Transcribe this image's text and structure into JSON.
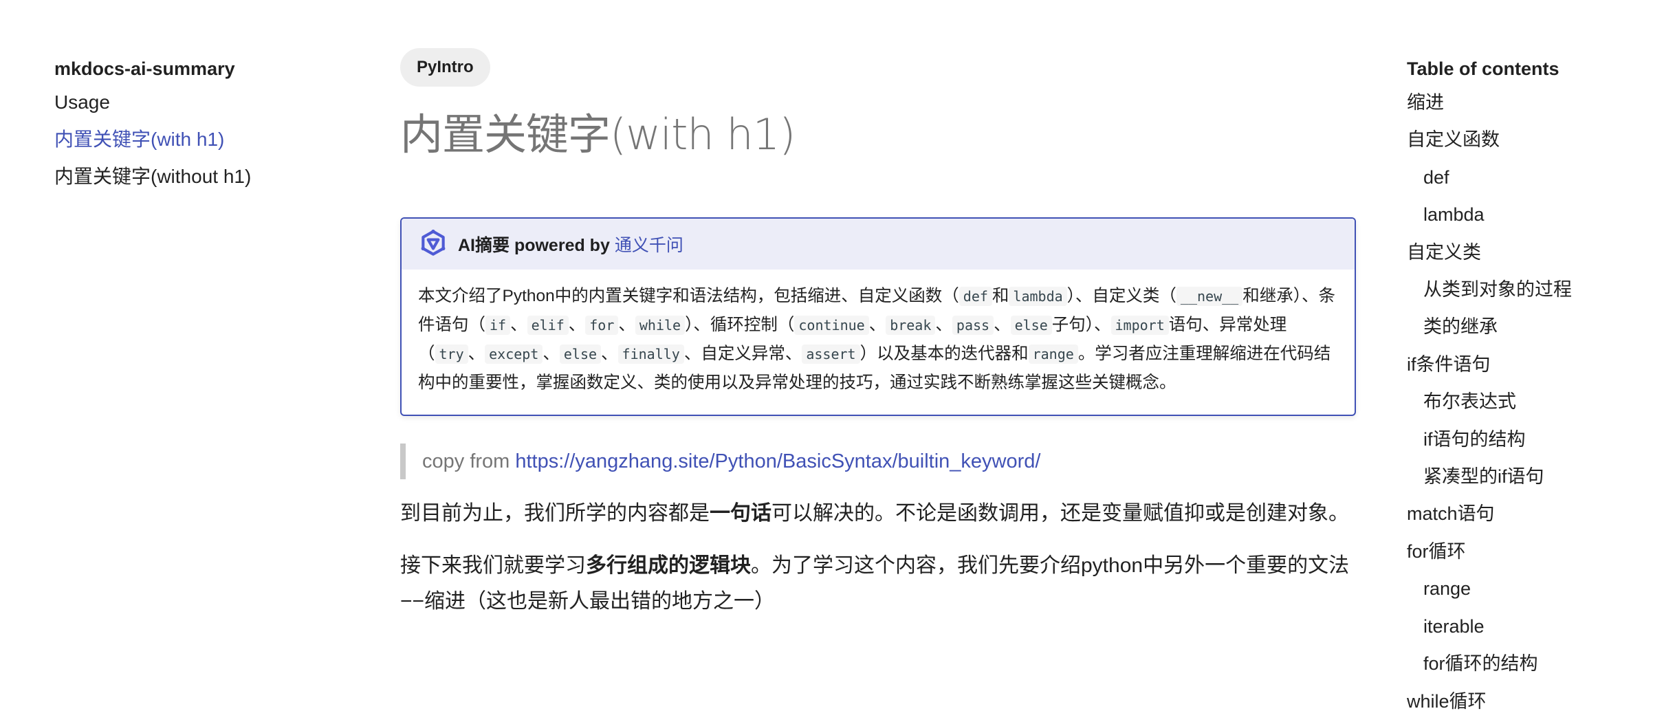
{
  "nav": {
    "site_title": "mkdocs-ai-summary",
    "items": [
      {
        "label": "Usage",
        "active": false
      },
      {
        "label": "内置关键字(with h1)",
        "active": true
      },
      {
        "label": "内置关键字(without h1)",
        "active": false
      }
    ]
  },
  "page": {
    "tag": "PyIntro",
    "title": "内置关键字(with h1)",
    "summary": {
      "title_prefix": "AI摘要 powered by",
      "title_link": "通义千问",
      "logo_icon": "tongyi-logo-icon",
      "accent_color": "#4051b5",
      "parts": {
        "t1": "本文介绍了Python中的内置关键字和语法结构，包括缩进、自定义函数（",
        "c_def": "def",
        "t2": "和",
        "c_lambda": "lambda",
        "t3": "）、自定义类（",
        "c_new": "__new__",
        "t4": "和继承）、条件语句（",
        "c_if": "if",
        "s1": "、",
        "c_elif": "elif",
        "s2": "、",
        "c_for": "for",
        "s3": "、",
        "c_while": "while",
        "t5": "）、循环控制（",
        "c_continue": "continue",
        "s4": "、",
        "c_break": "break",
        "s5": "、",
        "c_pass": "pass",
        "s6": "、",
        "c_else1": "else",
        "t6": "子句）、",
        "c_import": "import",
        "t7": "语句、异常处理（",
        "c_try": "try",
        "s7": "、",
        "c_except": "except",
        "s8": "、",
        "c_else2": "else",
        "s9": "、",
        "c_finally": "finally",
        "t8": "、自定义异常、",
        "c_assert": "assert",
        "t9": "）以及基本的迭代器和",
        "c_range": "range",
        "t10": "。学习者应注重理解缩进在代码结构中的重要性，掌握函数定义、类的使用以及异常处理的技巧，通过实践不断熟练掌握这些关键概念。"
      }
    },
    "quote": {
      "prefix": "copy from ",
      "link": "https://yangzhang.site/Python/BasicSyntax/builtin_keyword/"
    },
    "para1": {
      "a": "到目前为止，我们所学的内容都是",
      "b": "一句话",
      "c": "可以解决的。不论是函数调用，还是变量赋值抑或是创建对象。"
    },
    "para2": {
      "a": "接下来我们就要学习",
      "b": "多行组成的逻辑块",
      "c": "。为了学习这个内容，我们先要介绍python中另外一个重要的文法−−缩进（这也是新人最出错的地方之一）"
    }
  },
  "toc": {
    "title": "Table of contents",
    "items": [
      {
        "label": "缩进",
        "level": 1
      },
      {
        "label": "自定义函数",
        "level": 1
      },
      {
        "label": "def",
        "level": 2
      },
      {
        "label": "lambda",
        "level": 2
      },
      {
        "label": "自定义类",
        "level": 1
      },
      {
        "label": "从类到对象的过程",
        "level": 2
      },
      {
        "label": "类的继承",
        "level": 2
      },
      {
        "label": "if条件语句",
        "level": 1
      },
      {
        "label": "布尔表达式",
        "level": 2
      },
      {
        "label": "if语句的结构",
        "level": 2
      },
      {
        "label": "紧凑型的if语句",
        "level": 2
      },
      {
        "label": "match语句",
        "level": 1
      },
      {
        "label": "for循环",
        "level": 1
      },
      {
        "label": "range",
        "level": 2
      },
      {
        "label": "iterable",
        "level": 2
      },
      {
        "label": "for循环的结构",
        "level": 2
      },
      {
        "label": "while循环",
        "level": 1
      }
    ]
  }
}
